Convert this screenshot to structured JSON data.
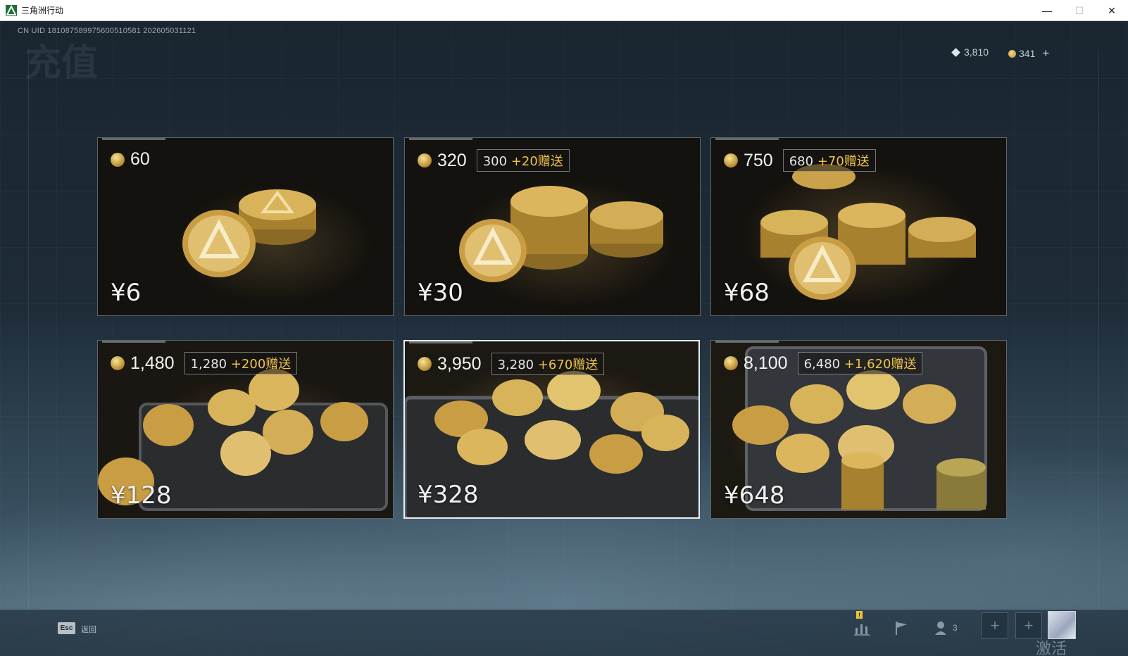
{
  "window": {
    "title": "三角洲行动",
    "minimize": "—",
    "maximize": "☐",
    "close": "✕"
  },
  "header": {
    "uid": "CN UID 181087589975600510581 202605031121",
    "page_title": "充值",
    "currencies": [
      {
        "icon": "diamond-icon",
        "value": "3,810"
      },
      {
        "icon": "coin-icon",
        "value": "341"
      }
    ],
    "add_label": "+"
  },
  "packages": [
    {
      "amount": "60",
      "bonus_base": "",
      "bonus_gift": "",
      "price": "¥6"
    },
    {
      "amount": "320",
      "bonus_base": "300",
      "bonus_gift": "+20赠送",
      "price": "¥30"
    },
    {
      "amount": "750",
      "bonus_base": "680",
      "bonus_gift": "+70赠送",
      "price": "¥68"
    },
    {
      "amount": "1,480",
      "bonus_base": "1,280",
      "bonus_gift": "+200赠送",
      "price": "¥128"
    },
    {
      "amount": "3,950",
      "bonus_base": "3,280",
      "bonus_gift": "+670赠送",
      "price": "¥328",
      "selected": true
    },
    {
      "amount": "8,100",
      "bonus_base": "6,480",
      "bonus_gift": "+1,620赠送",
      "price": "¥648"
    }
  ],
  "footer": {
    "esc_key": "Esc",
    "back_label": "返回",
    "notification": "!",
    "friend_count": "3",
    "add_slot": "+",
    "watermark": "激活 Windows"
  },
  "colors": {
    "gift_accent": "#f0c24a",
    "notification": "#f0c233"
  }
}
